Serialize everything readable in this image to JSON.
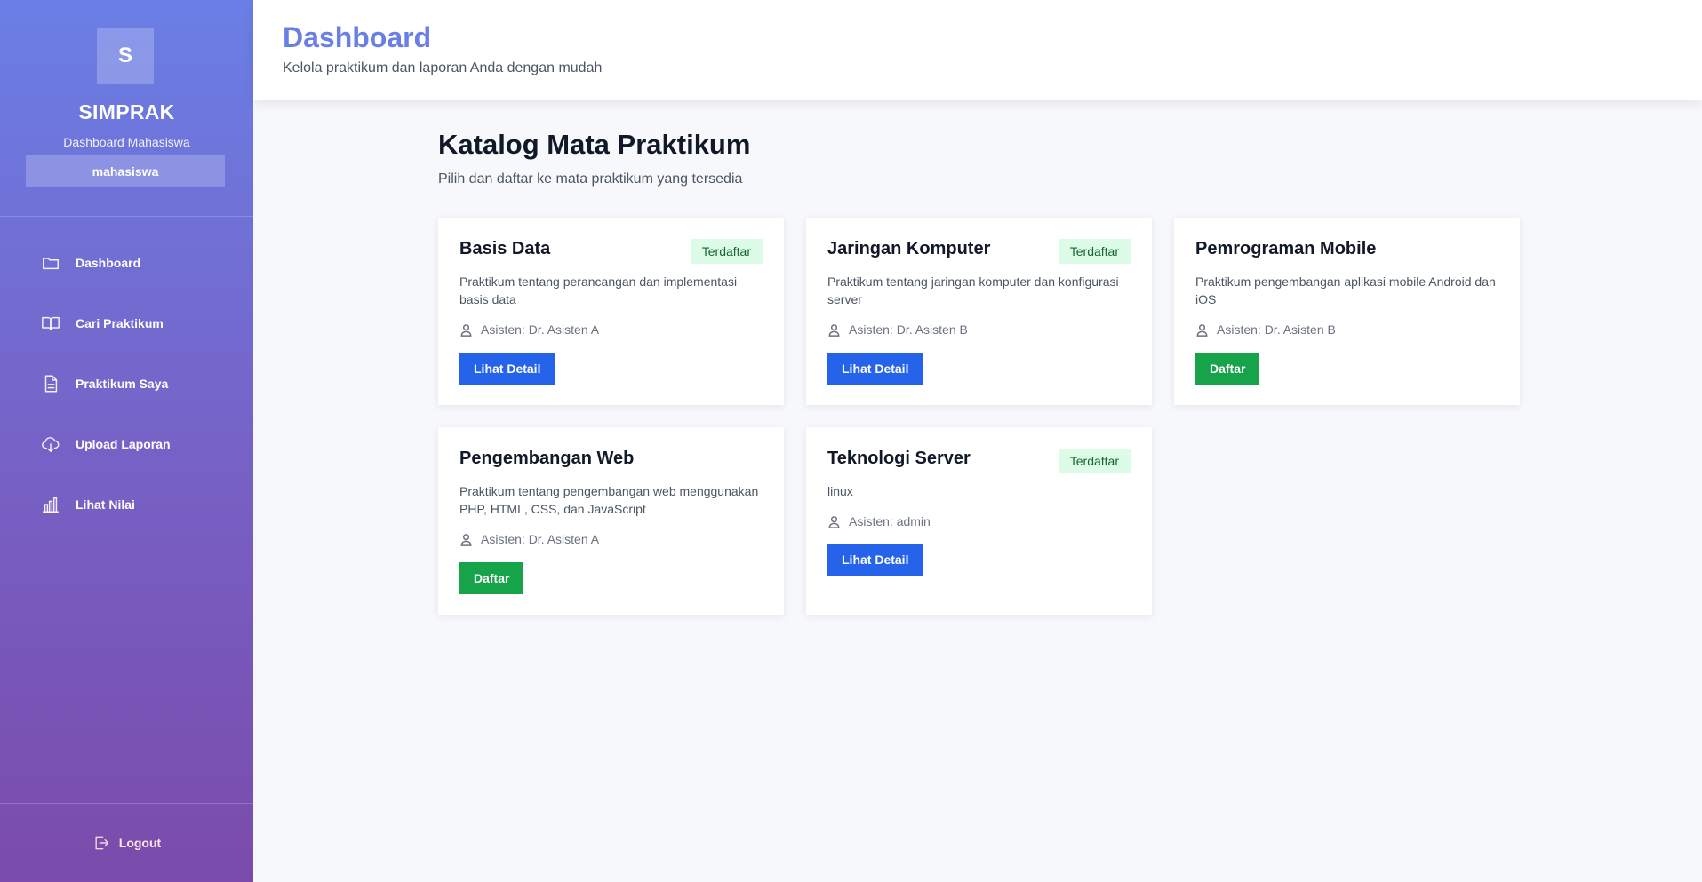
{
  "sidebar": {
    "logo_letter": "S",
    "app_name": "SIMPRAK",
    "subtitle": "Dashboard Mahasiswa",
    "role": "mahasiswa",
    "items": [
      {
        "label": "Dashboard",
        "icon": "folder-icon"
      },
      {
        "label": "Cari Praktikum",
        "icon": "book-open-icon"
      },
      {
        "label": "Praktikum Saya",
        "icon": "document-icon"
      },
      {
        "label": "Upload Laporan",
        "icon": "cloud-upload-icon"
      },
      {
        "label": "Lihat Nilai",
        "icon": "bar-chart-icon"
      }
    ],
    "logout_label": "Logout"
  },
  "header": {
    "title": "Dashboard",
    "subtitle": "Kelola praktikum dan laporan Anda dengan mudah"
  },
  "main": {
    "title": "Katalog Mata Praktikum",
    "lead": "Pilih dan daftar ke mata praktikum yang tersedia",
    "cards": [
      {
        "title": "Basis Data",
        "badge": "Terdaftar",
        "desc": "Praktikum tentang perancangan dan implementasi basis data",
        "assistant": "Asisten: Dr. Asisten A",
        "button": "Lihat Detail",
        "button_type": "detail"
      },
      {
        "title": "Jaringan Komputer",
        "badge": "Terdaftar",
        "desc": "Praktikum tentang jaringan komputer dan konfigurasi server",
        "assistant": "Asisten: Dr. Asisten B",
        "button": "Lihat Detail",
        "button_type": "detail"
      },
      {
        "title": "Pemrograman Mobile",
        "badge": "",
        "desc": "Praktikum pengembangan aplikasi mobile Android dan iOS",
        "assistant": "Asisten: Dr. Asisten B",
        "button": "Daftar",
        "button_type": "register"
      },
      {
        "title": "Pengembangan Web",
        "badge": "",
        "desc": "Praktikum tentang pengembangan web menggunakan PHP, HTML, CSS, dan JavaScript",
        "assistant": "Asisten: Dr. Asisten A",
        "button": "Daftar",
        "button_type": "register"
      },
      {
        "title": "Teknologi Server",
        "badge": "Terdaftar",
        "desc": "linux",
        "assistant": "Asisten: admin",
        "button": "Lihat Detail",
        "button_type": "detail"
      }
    ]
  },
  "colors": {
    "brand": "#6a7fe6",
    "detail_button": "#2563eb",
    "register_button": "#16a34a",
    "badge_bg": "#dcfce7",
    "badge_text": "#166534"
  }
}
